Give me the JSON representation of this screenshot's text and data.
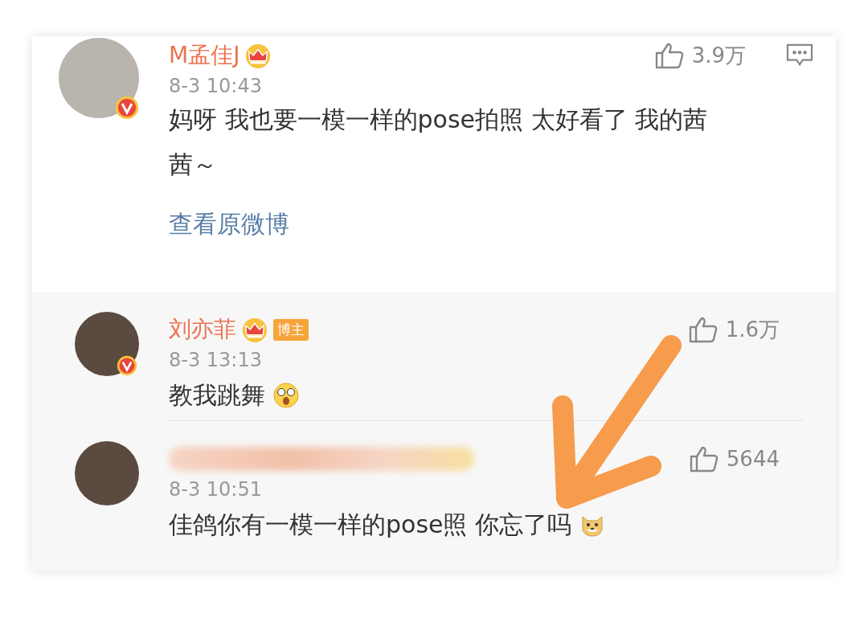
{
  "main_comment": {
    "user": "M孟佳J",
    "verified": true,
    "crown": true,
    "time": "8-3 10:43",
    "text": "妈呀 我也要一模一样的pose拍照  太好看了 我的茜茜～",
    "likes": "3.9万",
    "view_original": "查看原微博"
  },
  "replies": [
    {
      "user": "刘亦菲",
      "name_blurred": false,
      "verified": true,
      "crown": true,
      "badge": "博主",
      "time": "8-3 13:13",
      "text": "教我跳舞",
      "emoji": {
        "kind": "shocked"
      },
      "likes": "1.6万"
    },
    {
      "name_blurred": true,
      "verified": false,
      "crown": false,
      "time": "8-3 10:51",
      "text": "佳鸽你有一模一样的pose照 你忘了吗",
      "emoji": {
        "kind": "doge"
      },
      "likes": "5644"
    }
  ]
}
